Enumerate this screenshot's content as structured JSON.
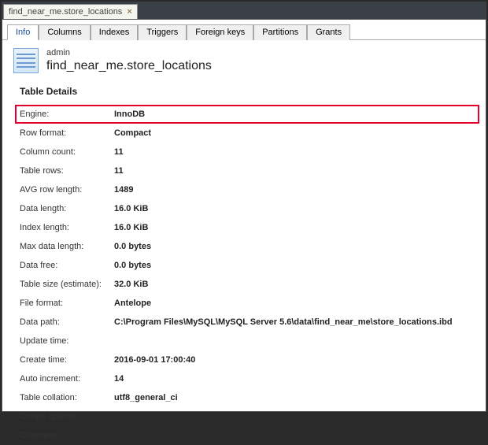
{
  "file_tab": {
    "label": "find_near_me.store_locations"
  },
  "inner_tabs": [
    {
      "label": "Info",
      "active": true
    },
    {
      "label": "Columns",
      "active": false
    },
    {
      "label": "Indexes",
      "active": false
    },
    {
      "label": "Triggers",
      "active": false
    },
    {
      "label": "Foreign keys",
      "active": false
    },
    {
      "label": "Partitions",
      "active": false
    },
    {
      "label": "Grants",
      "active": false
    }
  ],
  "header": {
    "owner": "admin",
    "title": "find_near_me.store_locations"
  },
  "section_title": "Table Details",
  "details": [
    {
      "label": "Engine:",
      "value": "InnoDB",
      "highlight": true
    },
    {
      "label": "Row format:",
      "value": "Compact"
    },
    {
      "label": "Column count:",
      "value": "11"
    },
    {
      "label": "Table rows:",
      "value": "11"
    },
    {
      "label": "AVG row length:",
      "value": "1489"
    },
    {
      "label": "Data length:",
      "value": "16.0 KiB"
    },
    {
      "label": "Index length:",
      "value": "16.0 KiB"
    },
    {
      "label": "Max data length:",
      "value": "0.0 bytes"
    },
    {
      "label": "Data free:",
      "value": "0.0 bytes"
    },
    {
      "label": "Table size (estimate):",
      "value": "32.0 KiB"
    },
    {
      "label": "File format:",
      "value": "Antelope"
    },
    {
      "label": "Data path:",
      "value": "C:\\Program Files\\MySQL\\MySQL Server 5.6\\data\\find_near_me\\store_locations.ibd"
    },
    {
      "label": "Update time:",
      "value": ""
    },
    {
      "label": "Create time:",
      "value": "2016-09-01 17:00:40"
    },
    {
      "label": "Auto increment:",
      "value": "14"
    },
    {
      "label": "Table collation:",
      "value": "utf8_general_ci"
    },
    {
      "label": "Create options:",
      "value": ""
    },
    {
      "label": "Comment:",
      "value": ""
    }
  ]
}
